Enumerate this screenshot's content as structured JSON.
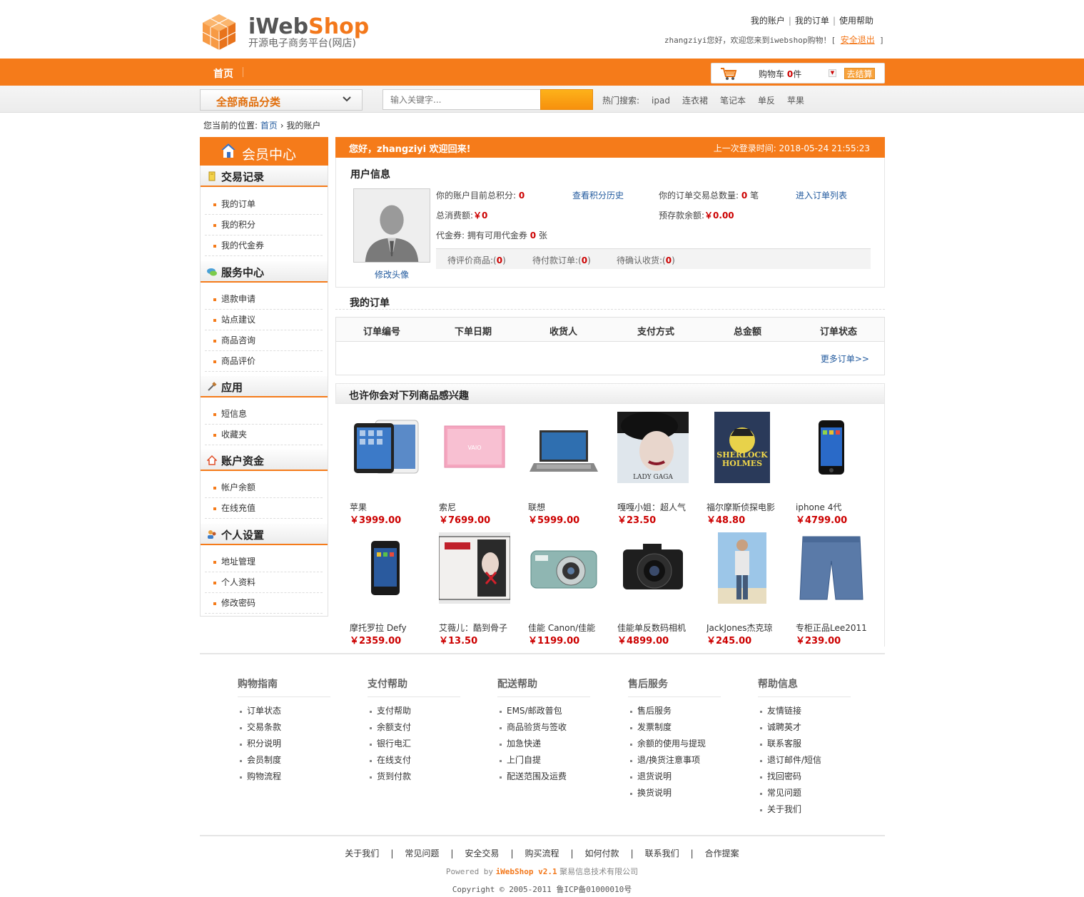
{
  "header": {
    "logo_title_a": "iWeb",
    "logo_title_b": "Shop",
    "logo_subtitle": "开源电子商务平台(网店)",
    "top_links": [
      "我的账户",
      "我的订单",
      "使用帮助"
    ],
    "welcome_text": "zhangziyi您好，欢迎您来到iwebshop购物！[",
    "logout_label": "安全退出",
    "welcome_close": "]"
  },
  "nav": {
    "home_label": "首页",
    "cart_label": "购物车",
    "cart_count": "0",
    "cart_unit": "件",
    "checkout_label": "去结算"
  },
  "search": {
    "category_label": "全部商品分类",
    "placeholder": "输入关键字...",
    "hot_label": "热门搜索:",
    "hot_keywords": [
      "ipad",
      "连衣裙",
      "笔记本",
      "单反",
      "苹果"
    ]
  },
  "breadcrumb": {
    "prefix": "您当前的位置:",
    "home": "首页",
    "sep": "›",
    "current": "我的账户"
  },
  "sidebar": {
    "title": "会员中心",
    "sections": [
      {
        "title": "交易记录",
        "items": [
          "我的订单",
          "我的积分",
          "我的代金券"
        ]
      },
      {
        "title": "服务中心",
        "items": [
          "退款申请",
          "站点建议",
          "商品咨询",
          "商品评价"
        ]
      },
      {
        "title": "应用",
        "items": [
          "短信息",
          "收藏夹"
        ]
      },
      {
        "title": "账户资金",
        "items": [
          "帐户余额",
          "在线充值"
        ]
      },
      {
        "title": "个人设置",
        "items": [
          "地址管理",
          "个人资料",
          "修改密码"
        ]
      }
    ]
  },
  "account": {
    "welcome": "您好，zhangziyi 欢迎回来!",
    "last_login": "上一次登录时间: 2018-05-24 21:55:23",
    "user_info_title": "用户信息",
    "edit_avatar": "修改头像",
    "points_label": "你的账户目前总积分:",
    "points_value": "0",
    "points_history": "查看积分历史",
    "orders_count_label": "你的订单交易总数量:",
    "orders_count_value": "0",
    "orders_count_unit": "笔",
    "orders_list_link": "进入订单列表",
    "total_spent_label": "总消费额:",
    "total_spent_value": "￥0",
    "deposit_label": "预存款余额:",
    "deposit_value": "￥0.00",
    "voucher_label": "代金券: 拥有可用代金券",
    "voucher_value": "0",
    "voucher_unit": "张",
    "pending": [
      {
        "label": "待评价商品:",
        "value": "0"
      },
      {
        "label": "待付款订单:",
        "value": "0"
      },
      {
        "label": "待确认收货:",
        "value": "0"
      }
    ]
  },
  "orders": {
    "title": "我的订单",
    "columns": [
      "订单编号",
      "下单日期",
      "收货人",
      "支付方式",
      "总金额",
      "订单状态"
    ],
    "more_link": "更多订单>>"
  },
  "recommend": {
    "title": "也许你会对下列商品感兴趣",
    "products": [
      {
        "name": "苹果",
        "price": "￥3999.00",
        "icon": "ipad-image"
      },
      {
        "name": "索尼",
        "price": "￥7699.00",
        "icon": "pink-laptop-image"
      },
      {
        "name": "联想",
        "price": "￥5999.00",
        "icon": "laptop-image"
      },
      {
        "name": "嘎嘎小姐：超人气",
        "price": "￥23.50",
        "icon": "lady-gaga-album-image"
      },
      {
        "name": "福尔摩斯侦探电影",
        "price": "￥48.80",
        "icon": "sherlock-holmes-book-image"
      },
      {
        "name": "iphone 4代",
        "price": "￥4799.00",
        "icon": "iphone-image"
      },
      {
        "name": "摩托罗拉 Defy",
        "price": "￥2359.00",
        "icon": "motorola-phone-image"
      },
      {
        "name": "艾薇儿：酷到骨子",
        "price": "￥13.50",
        "icon": "avril-album-image"
      },
      {
        "name": "佳能 Canon/佳能",
        "price": "￥1199.00",
        "icon": "compact-camera-image"
      },
      {
        "name": "佳能单反数码相机",
        "price": "￥4899.00",
        "icon": "dslr-camera-image"
      },
      {
        "name": "JackJones杰克琼",
        "price": "￥245.00",
        "icon": "man-fashion-image"
      },
      {
        "name": "专柜正品Lee2011",
        "price": "￥239.00",
        "icon": "jeans-shorts-image"
      }
    ]
  },
  "footer": {
    "columns": [
      {
        "title": "购物指南",
        "links": [
          "订单状态",
          "交易条款",
          "积分说明",
          "会员制度",
          "购物流程"
        ]
      },
      {
        "title": "支付帮助",
        "links": [
          "支付帮助",
          "余额支付",
          "银行电汇",
          "在线支付",
          "货到付款"
        ]
      },
      {
        "title": "配送帮助",
        "links": [
          "EMS/邮政普包",
          "商品验货与签收",
          "加急快递",
          "上门自提",
          "配送范围及运费"
        ]
      },
      {
        "title": "售后服务",
        "links": [
          "售后服务",
          "发票制度",
          "余额的使用与提现",
          "退/换货注意事项",
          "退货说明",
          "换货说明"
        ]
      },
      {
        "title": "帮助信息",
        "links": [
          "友情链接",
          "诚聘英才",
          "联系客服",
          "退订邮件/短信",
          "找回密码",
          "常见问题",
          "关于我们"
        ]
      }
    ],
    "bottom_links": [
      "关于我们",
      "常见问题",
      "安全交易",
      "购买流程",
      "如何付款",
      "联系我们",
      "合作提案"
    ],
    "bottom_sep": "|",
    "powered_prefix": "Powered by",
    "powered_brand": "iWebShop v2.1",
    "powered_company": "聚易信息技术有限公司",
    "copyright": "Copyright © 2005-2011 鲁ICP备01000010号"
  },
  "colors": {
    "accent": "#f57b1a",
    "price": "#cc0000",
    "link": "#225a9e"
  }
}
